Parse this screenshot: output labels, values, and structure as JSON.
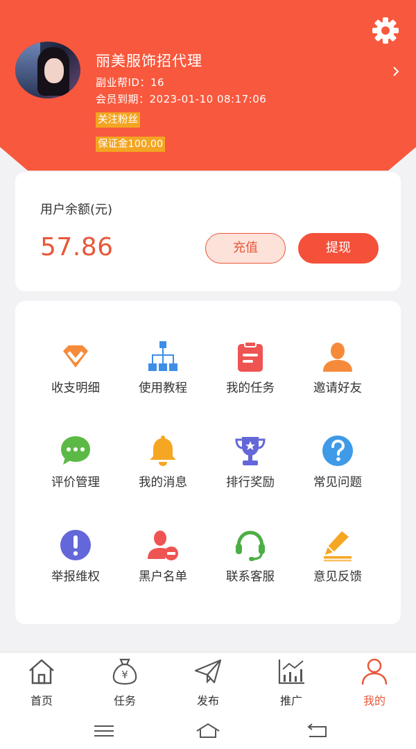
{
  "profile": {
    "name": "丽美服饰招代理",
    "id_line": "副业帮ID：16",
    "expiry_line": "会员到期：2023-01-10 08:17:06",
    "tag_follow": "关注粉丝",
    "tag_deposit": "保证金100.00"
  },
  "balance": {
    "label": "用户余额(元)",
    "value": "57.86",
    "recharge": "充值",
    "withdraw": "提现"
  },
  "menu": [
    {
      "label": "收支明细",
      "icon": "diamond-icon"
    },
    {
      "label": "使用教程",
      "icon": "hierarchy-icon"
    },
    {
      "label": "我的任务",
      "icon": "clipboard-icon"
    },
    {
      "label": "邀请好友",
      "icon": "user-icon"
    },
    {
      "label": "评价管理",
      "icon": "chat-icon"
    },
    {
      "label": "我的消息",
      "icon": "bell-icon"
    },
    {
      "label": "排行奖励",
      "icon": "trophy-icon"
    },
    {
      "label": "常见问题",
      "icon": "question-icon"
    },
    {
      "label": "举报维权",
      "icon": "exclamation-icon"
    },
    {
      "label": "黑户名单",
      "icon": "user-block-icon"
    },
    {
      "label": "联系客服",
      "icon": "headset-icon"
    },
    {
      "label": "意见反馈",
      "icon": "pen-icon"
    }
  ],
  "tabs": [
    {
      "label": "首页",
      "icon": "home-icon"
    },
    {
      "label": "任务",
      "icon": "money-bag-icon"
    },
    {
      "label": "发布",
      "icon": "send-icon"
    },
    {
      "label": "推广",
      "icon": "chart-icon"
    },
    {
      "label": "我的",
      "icon": "person-icon"
    }
  ],
  "colors": {
    "brand": "#f8583d",
    "accent_text": "#e8573a",
    "tag_bg": "#f3a522"
  }
}
